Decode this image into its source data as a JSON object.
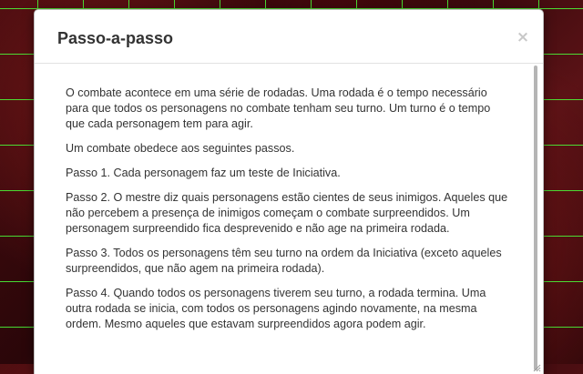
{
  "dialog": {
    "title": "Passo-a-passo",
    "close_label": "×"
  },
  "body": {
    "paragraphs": [
      "O combate acontece em uma série de rodadas. Uma rodada é o tempo necessário para que todos os personagens no combate tenham seu turno. Um turno é o tempo que cada personagem tem para agir.",
      "Um combate obedece aos seguintes passos.",
      "Passo 1. Cada personagem faz um teste de Iniciativa.",
      "Passo 2. O mestre diz quais personagens estão cientes de seus inimigos. Aqueles que não percebem a presença de inimigos começam o combate surpreendidos. Um personagem surpreendido fica desprevenido e não age na primeira rodada.",
      "Passo 3. Todos os personagens têm seu turno na ordem da Iniciativa (exceto aqueles surpreendidos, que não agem na primeira rodada).",
      "Passo 4. Quando todos os personagens tiverem seu turno, a rodada termina. Uma outra rodada se inicia, com todos os personagens agindo novamente, na mesma ordem. Mesmo aqueles que estavam surpreendidos agora podem agir."
    ]
  },
  "colors": {
    "grid": "#4cff3a",
    "background": "#3a0a0d",
    "title_text": "#333333",
    "close_icon": "#c8c8c8"
  }
}
